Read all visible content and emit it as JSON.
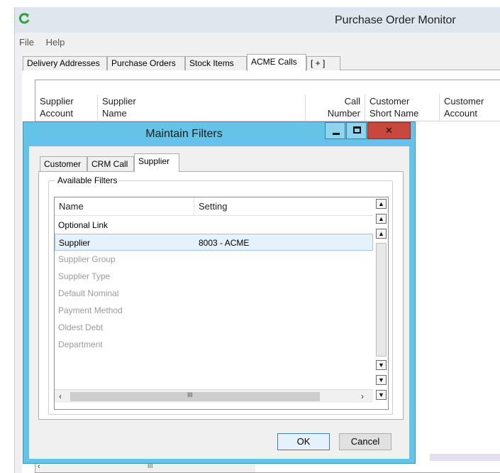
{
  "main_window": {
    "title": "Purchase Order Monitor",
    "menu": [
      "File",
      "Help"
    ],
    "tabs": [
      {
        "label": "Delivery Addresses"
      },
      {
        "label": "Purchase Orders"
      },
      {
        "label": "Stock Items"
      },
      {
        "label": "ACME Calls",
        "active": true
      },
      {
        "label": "[ + ]"
      }
    ],
    "grid_columns": [
      {
        "line1": "Supplier",
        "line2": "Account"
      },
      {
        "line1": "Supplier",
        "line2": "Name"
      },
      {
        "line1": "Call",
        "line2": "Number"
      },
      {
        "line1": "Customer",
        "line2": "Short Name"
      },
      {
        "line1": "Customer",
        "line2": "Account"
      }
    ],
    "scroll_grip": "III"
  },
  "dialog": {
    "title": "Maintain Filters",
    "tabs": [
      {
        "label": "Customer"
      },
      {
        "label": "CRM Call"
      },
      {
        "label": "Supplier",
        "active": true
      }
    ],
    "group_caption": "Available Filters",
    "columns": {
      "name": "Name",
      "setting": "Setting"
    },
    "rows": [
      {
        "name": "Optional Link",
        "setting": "",
        "enabled": true,
        "selected": false
      },
      {
        "name": "Supplier",
        "setting": "8003 - ACME",
        "enabled": true,
        "selected": true
      },
      {
        "name": "Supplier Group",
        "setting": "",
        "enabled": false,
        "selected": false
      },
      {
        "name": "Supplier Type",
        "setting": "",
        "enabled": false,
        "selected": false
      },
      {
        "name": "Default Nominal",
        "setting": "",
        "enabled": false,
        "selected": false
      },
      {
        "name": "Payment Method",
        "setting": "",
        "enabled": false,
        "selected": false
      },
      {
        "name": "Oldest Debt",
        "setting": "",
        "enabled": false,
        "selected": false
      },
      {
        "name": "Department",
        "setting": "",
        "enabled": false,
        "selected": false
      }
    ],
    "scroll_grip": "III",
    "buttons": {
      "ok": "OK",
      "cancel": "Cancel"
    }
  },
  "icons": {
    "app": "refresh-arrow-icon",
    "minimize": "minimize-icon",
    "maximize": "maximize-icon",
    "close": "close-icon"
  },
  "colors": {
    "dialog_frame": "#66c3e8",
    "close_button": "#c9473c",
    "selection": "#e5f1fb",
    "app_icon": "#2e9e3f"
  }
}
